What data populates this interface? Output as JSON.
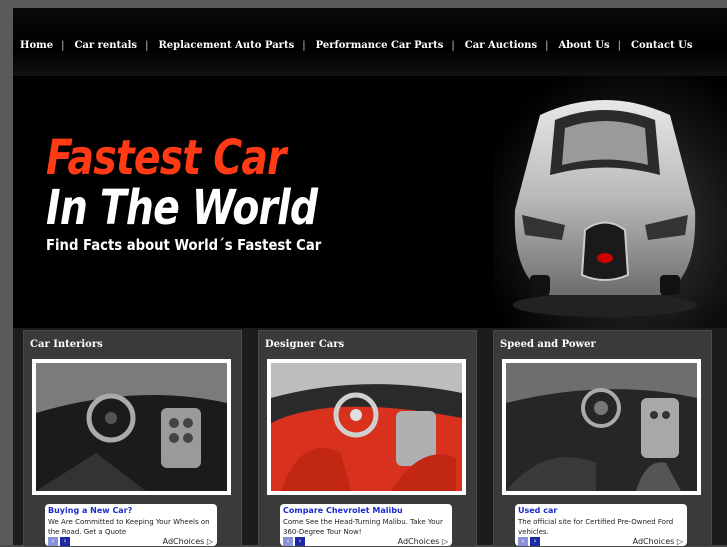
{
  "nav": {
    "items": [
      "Home",
      "Car rentals",
      "Replacement Auto Parts",
      "Performance Car Parts",
      "Car Auctions",
      "About Us",
      "Contact Us"
    ]
  },
  "hero": {
    "title_line1": "Fastest Car",
    "title_line2": "In The World",
    "tagline": "Find Facts about World´s Fastest Car"
  },
  "sections": [
    {
      "title": "Car Interiors",
      "ad": {
        "title": "Buying a New Car?",
        "body": "We Are Committed to Keeping Your Wheels on the Road. Get a Quote",
        "choices": "AdChoices ▷"
      }
    },
    {
      "title": "Designer Cars",
      "ad": {
        "title": "Compare Chevrolet Malibu",
        "body": "Come See the Head-Turning Malibu. Take Your 360-Degree Tour Now!",
        "choices": "AdChoices ▷"
      }
    },
    {
      "title": "Speed and Power",
      "ad": {
        "title": "Used car",
        "body": "The official site for Certified Pre-Owned Ford vehicles.",
        "choices": "AdChoices ▷"
      }
    }
  ],
  "colors": {
    "accent_red": "#ff3a14",
    "ad_link": "#1a2ad0"
  }
}
